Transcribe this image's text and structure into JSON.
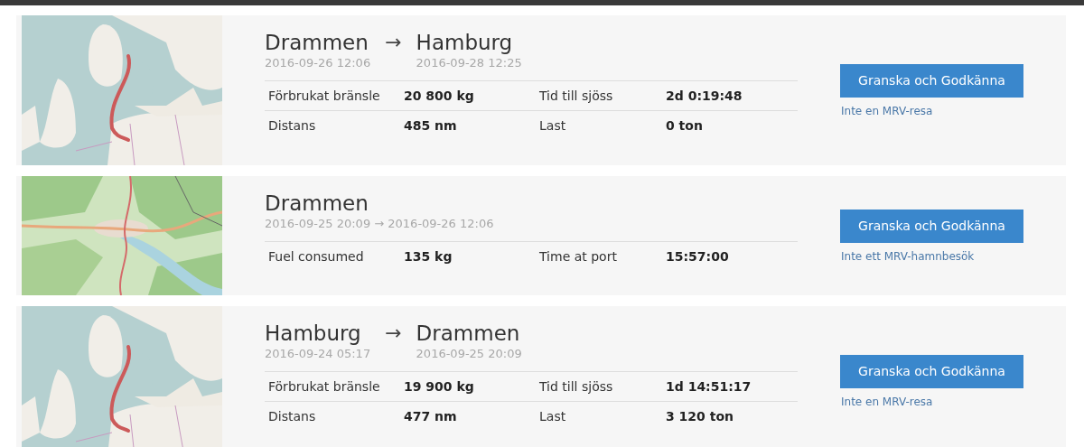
{
  "trips": [
    {
      "kind": "voyage",
      "from": {
        "place": "Drammen",
        "time": "2016-09-26 12:06"
      },
      "arrow": "→",
      "to": {
        "place": "Hamburg",
        "time": "2016-09-28 12:25"
      },
      "stats": [
        [
          {
            "label": "Förbrukat bränsle",
            "value": "20 800 kg"
          },
          {
            "label": "Tid till sjöss",
            "value": "2d 0:19:48"
          }
        ],
        [
          {
            "label": "Distans",
            "value": "485 nm"
          },
          {
            "label": "Last",
            "value": "0 ton"
          }
        ]
      ],
      "button": "Granska och Godkänna",
      "link": "Inte en MRV-resa"
    },
    {
      "kind": "port",
      "place": "Drammen",
      "period": "2016-09-25 20:09 → 2016-09-26 12:06",
      "stats": [
        [
          {
            "label": "Fuel consumed",
            "value": "135 kg"
          },
          {
            "label": "Time at port",
            "value": "15:57:00"
          }
        ]
      ],
      "button": "Granska och Godkänna",
      "link": "Inte ett MRV-hamnbesök"
    },
    {
      "kind": "voyage",
      "from": {
        "place": "Hamburg",
        "time": "2016-09-24 05:17"
      },
      "arrow": "→",
      "to": {
        "place": "Drammen",
        "time": "2016-09-25 20:09"
      },
      "stats": [
        [
          {
            "label": "Förbrukat bränsle",
            "value": "19 900 kg"
          },
          {
            "label": "Tid till sjöss",
            "value": "1d 14:51:17"
          }
        ],
        [
          {
            "label": "Distans",
            "value": "477 nm"
          },
          {
            "label": "Last",
            "value": "3 120 ton"
          }
        ]
      ],
      "button": "Granska och Godkänna",
      "link": "Inte en MRV-resa"
    }
  ]
}
